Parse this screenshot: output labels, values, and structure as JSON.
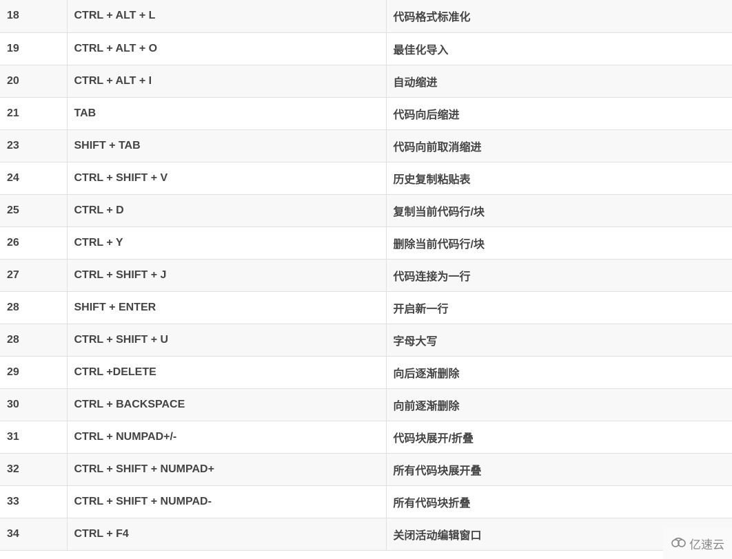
{
  "rows": [
    {
      "num": "18",
      "keys": "CTRL + ALT + L",
      "desc": "代码格式标准化"
    },
    {
      "num": "19",
      "keys": "CTRL + ALT + O",
      "desc": "最佳化导入"
    },
    {
      "num": "20",
      "keys": "CTRL + ALT + I",
      "desc": "自动缩进"
    },
    {
      "num": "21",
      "keys": "TAB",
      "desc": "代码向后缩进"
    },
    {
      "num": "23",
      "keys": "SHIFT + TAB",
      "desc": "代码向前取消缩进"
    },
    {
      "num": "24",
      "keys": "CTRL + SHIFT + V",
      "desc": "历史复制粘贴表"
    },
    {
      "num": "25",
      "keys": "CTRL + D",
      "desc": "复制当前代码行/块"
    },
    {
      "num": "26",
      "keys": "CTRL + Y",
      "desc": "删除当前代码行/块"
    },
    {
      "num": "27",
      "keys": "CTRL + SHIFT + J",
      "desc": "代码连接为一行"
    },
    {
      "num": "28",
      "keys": "SHIFT + ENTER",
      "desc": "开启新一行"
    },
    {
      "num": "28",
      "keys": "CTRL + SHIFT + U",
      "desc": "字母大写"
    },
    {
      "num": "29",
      "keys": "CTRL +DELETE",
      "desc": "向后逐渐删除"
    },
    {
      "num": "30",
      "keys": "CTRL + BACKSPACE",
      "desc": "向前逐渐删除"
    },
    {
      "num": "31",
      "keys": "CTRL + NUMPAD+/-",
      "desc": "代码块展开/折叠"
    },
    {
      "num": "32",
      "keys": "CTRL + SHIFT + NUMPAD+",
      "desc": "所有代码块展开叠"
    },
    {
      "num": "33",
      "keys": "CTRL + SHIFT + NUMPAD-",
      "desc": "所有代码块折叠"
    },
    {
      "num": "34",
      "keys": "CTRL + F4",
      "desc": "关闭活动编辑窗口"
    }
  ],
  "watermark": {
    "text": "亿速云",
    "icon": "cloud-logo-icon"
  }
}
